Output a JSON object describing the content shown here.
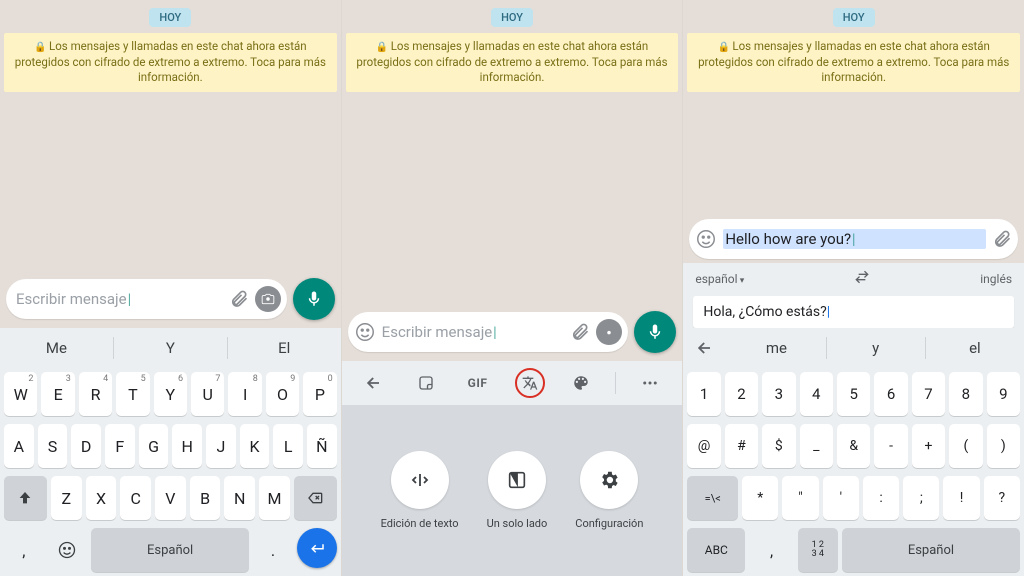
{
  "common": {
    "date_chip": "HOY",
    "encryption_notice": "Los mensajes y llamadas en este chat ahora están protegidos con cifrado de extremo a extremo. Toca para más información.",
    "placeholder": "Escribir mensaje"
  },
  "panel1": {
    "suggestions": [
      "Me",
      "Y",
      "El"
    ],
    "row1": [
      "W",
      "E",
      "R",
      "T",
      "Y",
      "U",
      "I",
      "O",
      "P"
    ],
    "row1_sup": [
      "2",
      "3",
      "4",
      "5",
      "6",
      "7",
      "8",
      "9",
      "0"
    ],
    "row2": [
      "A",
      "S",
      "D",
      "F",
      "G",
      "H",
      "J",
      "K",
      "L",
      "Ñ"
    ],
    "row3": [
      "Z",
      "X",
      "C",
      "V",
      "B",
      "N",
      "M"
    ],
    "space_label": "Español",
    "bottom_left_comma": ",",
    "bottom_dot": "."
  },
  "panel2": {
    "gif_label": "GIF",
    "tools": {
      "edit": "Edición de texto",
      "one_side": "Un solo lado",
      "settings": "Configuración"
    }
  },
  "panel3": {
    "typed_message": "Hello how are you?",
    "lang_from": "español",
    "lang_to": "inglés",
    "translation": "Hola, ¿Cómo estás?",
    "suggestions": [
      "me",
      "y",
      "el"
    ],
    "numrow": [
      "1",
      "2",
      "3",
      "4",
      "5",
      "6",
      "7",
      "8",
      "9"
    ],
    "symrow1": [
      "@",
      "#",
      "$",
      "_",
      "&",
      "-",
      "+",
      "(",
      ")"
    ],
    "symrow2_lead": "=\\<",
    "symrow2": [
      "*",
      "\"",
      "'",
      ":",
      ";",
      "!",
      "?"
    ],
    "abc_label": "ABC",
    "frac_label": "1 2\n3 4",
    "space_label": "Español",
    "bottom_left_comma": ","
  }
}
